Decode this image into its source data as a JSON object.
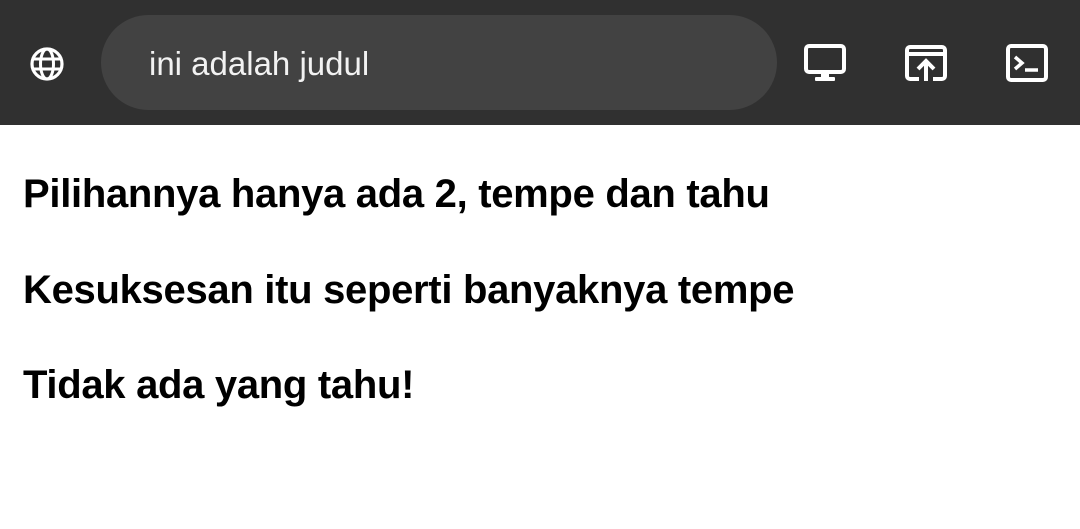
{
  "toolbar": {
    "site_icon": "globe-icon",
    "page_title": "ini adalah judul",
    "actions": [
      {
        "icon": "desktop-icon"
      },
      {
        "icon": "open-in-browser-icon"
      },
      {
        "icon": "terminal-icon"
      }
    ]
  },
  "content": {
    "lines": [
      "Pilihannya hanya ada 2, tempe dan tahu",
      "Kesuksesan itu seperti banyaknya tempe",
      "Tidak ada yang tahu!"
    ]
  }
}
